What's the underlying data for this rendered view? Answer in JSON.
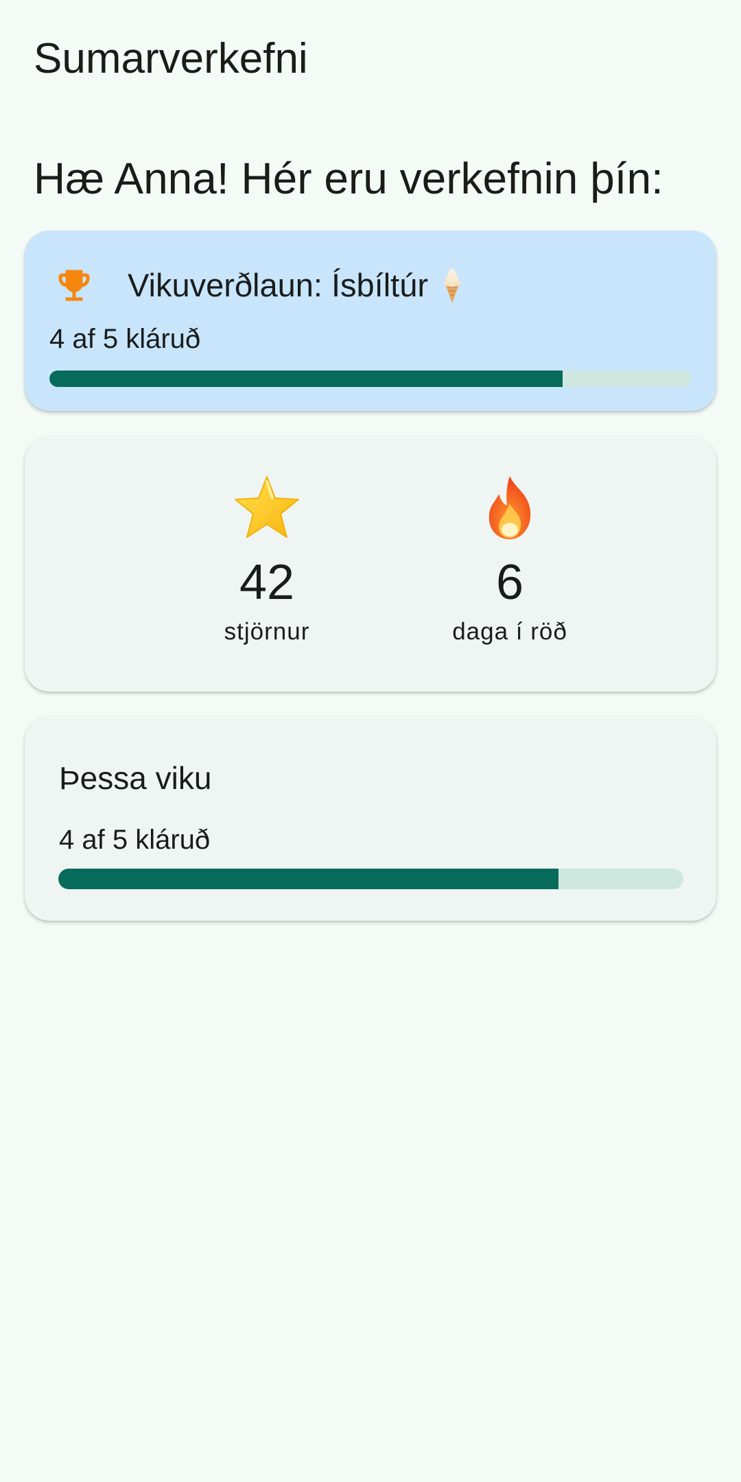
{
  "app": {
    "title": "Sumarverkefni",
    "greeting": "Hæ Anna! Hér eru verkefnin þín:"
  },
  "reward_card": {
    "icon": "trophy-icon",
    "title": "Vikuverðlaun: Ísbíltúr",
    "title_icon": "ice-cream-icon",
    "progress_text": "4 af 5 kláruð",
    "completed": 4,
    "total": 5
  },
  "stats": {
    "stars": {
      "icon": "star-icon",
      "value": "42",
      "label": "stjörnur"
    },
    "streak": {
      "icon": "fire-icon",
      "value": "6",
      "label": "daga í röð"
    }
  },
  "week_card": {
    "title": "Þessa viku",
    "progress_text": "4 af 5 kláruð",
    "completed": 4,
    "total": 5
  },
  "colors": {
    "background": "#f4fbf6",
    "reward_card": "#c8e5fc",
    "card": "#eef5f2",
    "progress_fill": "#076b5c",
    "progress_track": "#cfe8df",
    "trophy": "#f5870f"
  }
}
